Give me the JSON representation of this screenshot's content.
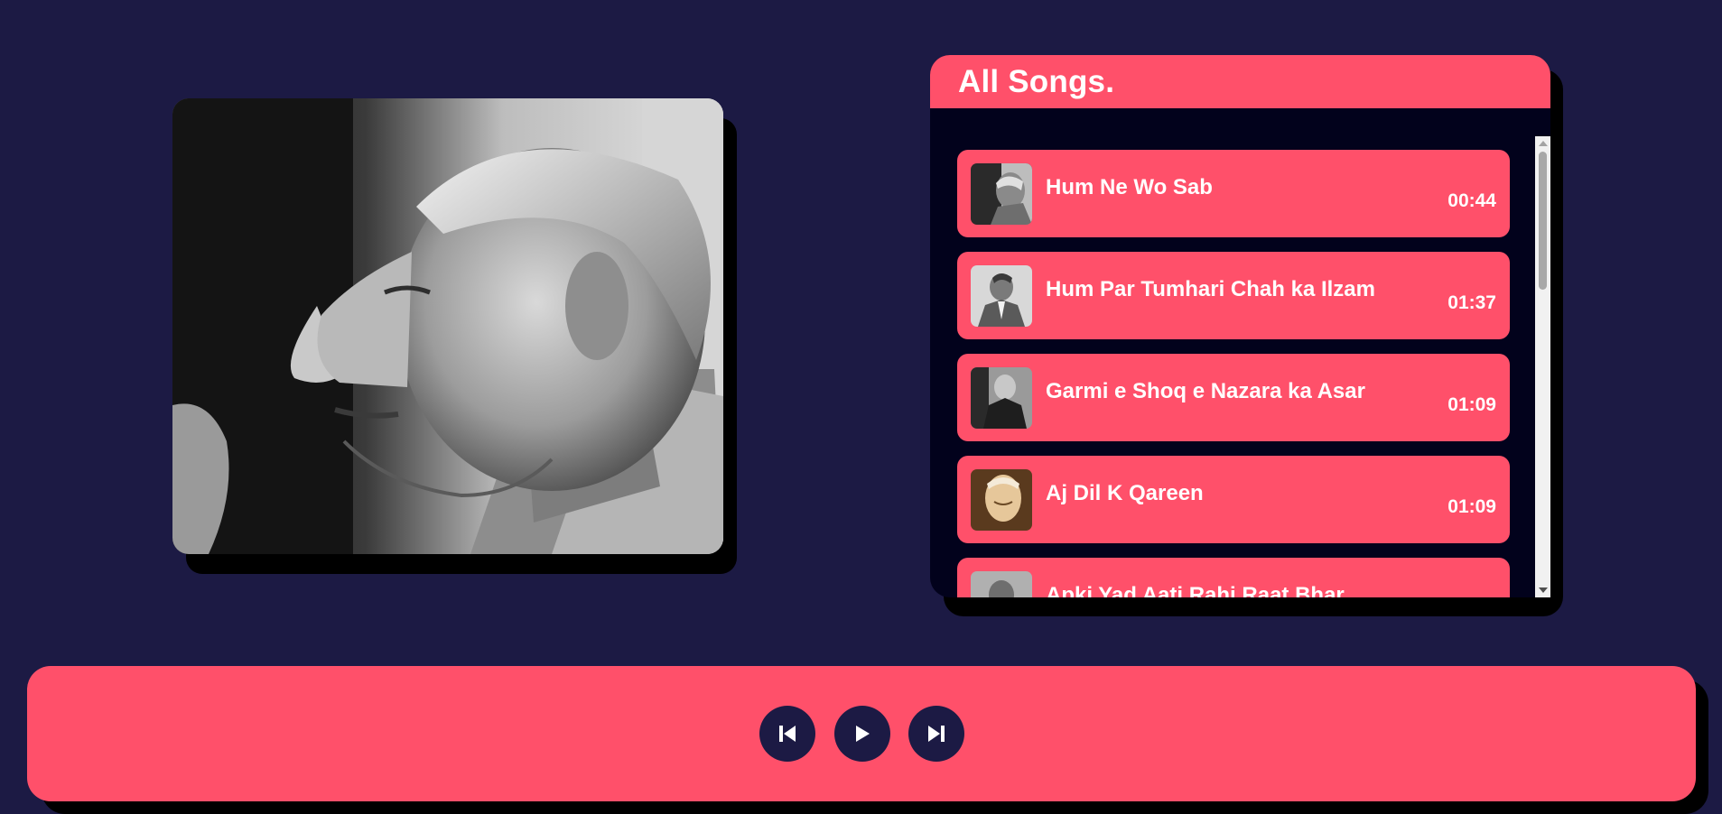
{
  "playlist": {
    "title": "All Songs.",
    "songs": [
      {
        "title": "Hum Ne Wo Sab",
        "duration": "00:44"
      },
      {
        "title": "Hum Par Tumhari Chah ka Ilzam",
        "duration": "01:37"
      },
      {
        "title": "Garmi e Shoq e Nazara ka Asar",
        "duration": "01:09"
      },
      {
        "title": "Aj Dil K Qareen",
        "duration": "01:09"
      },
      {
        "title": "Apki Yad Aati Rahi Raat Bhar",
        "duration": ""
      }
    ]
  },
  "controls": {
    "previous_icon": "skip-back-icon",
    "play_icon": "play-icon",
    "next_icon": "skip-forward-icon"
  },
  "colors": {
    "background": "#1c1a44",
    "accent": "#ff506a",
    "panel": "#02021c"
  }
}
